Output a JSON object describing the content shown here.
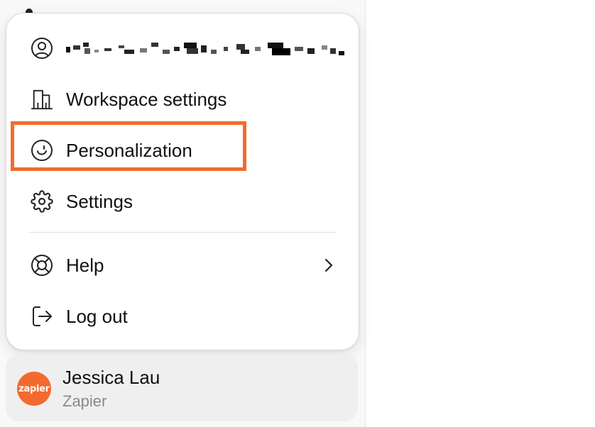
{
  "menu": {
    "account": {
      "icon": "user-circle-icon",
      "label_redacted": true
    },
    "items": [
      {
        "label": "Workspace settings",
        "icon": "building-icon"
      },
      {
        "label": "Personalization",
        "icon": "smiley-icon"
      },
      {
        "label": "Settings",
        "icon": "gear-icon"
      },
      {
        "label": "Help",
        "icon": "lifebuoy-icon"
      },
      {
        "label": "Log out",
        "icon": "logout-icon"
      }
    ],
    "help_submenu_icon": "chevron-right-icon"
  },
  "highlight": {
    "target": "Personalization",
    "color": "#f26d2c"
  },
  "profile": {
    "name": "Jessica Lau",
    "organization": "Zapier",
    "avatar_text": "zapier",
    "avatar_color": "#f26a2e"
  }
}
